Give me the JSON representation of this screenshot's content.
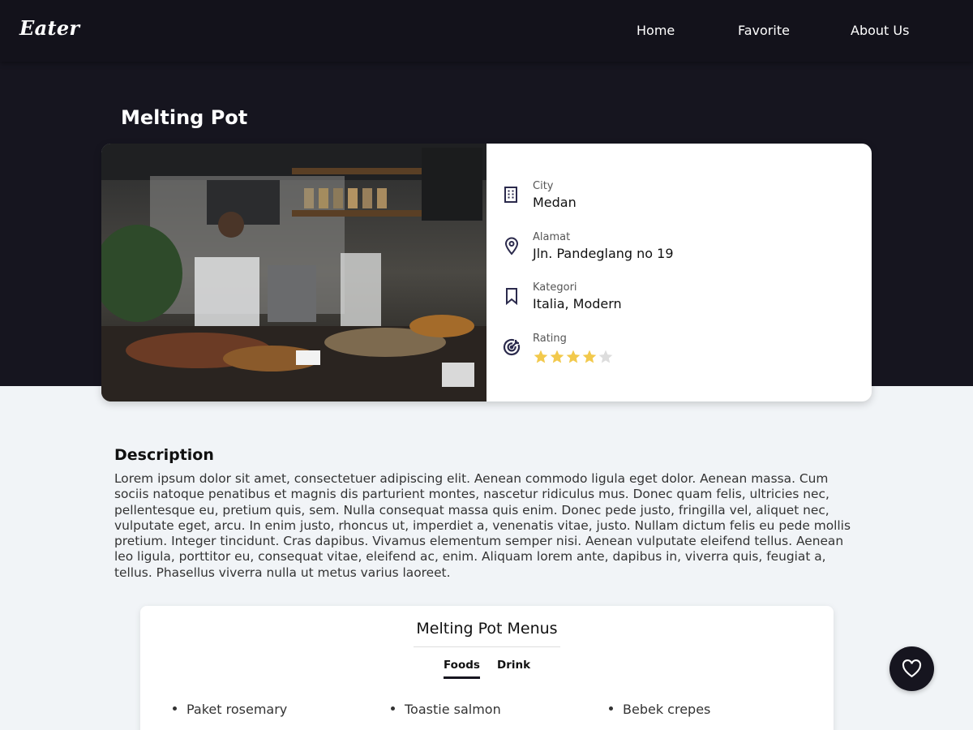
{
  "navbar": {
    "logo": "Eater",
    "links": [
      "Home",
      "Favorite",
      "About Us"
    ]
  },
  "restaurant": {
    "name": "Melting Pot",
    "photo_alt": "restaurant kitchen photo",
    "info": {
      "city": {
        "label": "City",
        "value": "Medan",
        "icon": "building-icon"
      },
      "address": {
        "label": "Alamat",
        "value": "Jln. Pandeglang no 19",
        "icon": "map-pin-icon"
      },
      "category": {
        "label": "Kategori",
        "value": "Italia, Modern",
        "icon": "bookmark-icon"
      },
      "rating": {
        "label": "Rating",
        "value": 4,
        "max": 5,
        "icon": "target-icon"
      }
    }
  },
  "description": {
    "title": "Description",
    "body": "Lorem ipsum dolor sit amet, consectetuer adipiscing elit. Aenean commodo ligula eget dolor. Aenean massa. Cum sociis natoque penatibus et magnis dis parturient montes, nascetur ridiculus mus. Donec quam felis, ultricies nec, pellentesque eu, pretium quis, sem. Nulla consequat massa quis enim. Donec pede justo, fringilla vel, aliquet nec, vulputate eget, arcu. In enim justo, rhoncus ut, imperdiet a, venenatis vitae, justo. Nullam dictum felis eu pede mollis pretium. Integer tincidunt. Cras dapibus. Vivamus elementum semper nisi. Aenean vulputate eleifend tellus. Aenean leo ligula, porttitor eu, consequat vitae, eleifend ac, enim. Aliquam lorem ante, dapibus in, viverra quis, feugiat a, tellus. Phasellus viverra nulla ut metus varius laoreet."
  },
  "menus": {
    "title": "Melting Pot Menus",
    "tabs": [
      "Foods",
      "Drink"
    ],
    "active_tab": "Foods",
    "items": [
      "Paket rosemary",
      "Toastie salmon",
      "Bebek crepes"
    ]
  },
  "favorite_button": {
    "icon": "heart-icon"
  },
  "colors": {
    "dark_bg": "#16151f",
    "navbar_bg": "#13121b",
    "page_bg": "#f1f4f7",
    "star_filled": "#f2c94c",
    "star_empty": "#dddddd",
    "icon_color": "#2b2a4c"
  }
}
